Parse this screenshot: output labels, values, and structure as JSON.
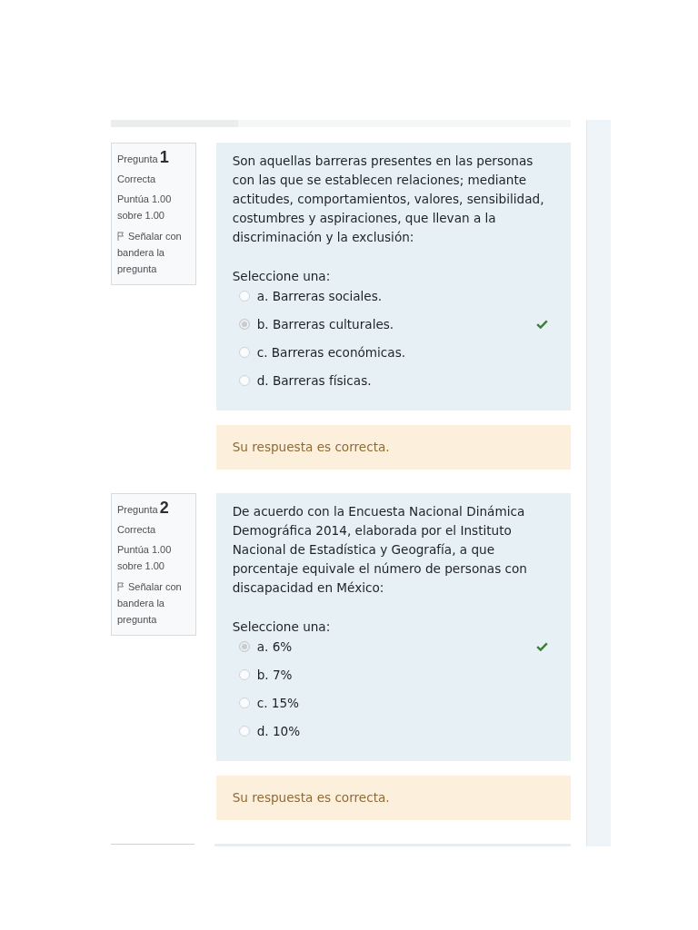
{
  "questions": [
    {
      "label": "Pregunta",
      "number": "1",
      "status": "Correcta",
      "grade": "Puntúa 1.00 sobre 1.00",
      "flag_link": "Señalar con bandera la pregunta",
      "text": "Son aquellas barreras presentes en las personas con las que se establecen relaciones; mediante actitudes, comportamientos, valores, sensibilidad, costumbres y aspiraciones, que llevan a la discriminación y la exclusión:",
      "prompt": "Seleccione una:",
      "options": [
        {
          "label": "a. Barreras sociales.",
          "selected": false,
          "correct": false
        },
        {
          "label": "b. Barreras culturales.",
          "selected": true,
          "correct": true
        },
        {
          "label": "c. Barreras económicas.",
          "selected": false,
          "correct": false
        },
        {
          "label": "d. Barreras físicas.",
          "selected": false,
          "correct": false
        }
      ],
      "feedback": "Su respuesta es correcta."
    },
    {
      "label": "Pregunta",
      "number": "2",
      "status": "Correcta",
      "grade": "Puntúa 1.00 sobre 1.00",
      "flag_link": "Señalar con bandera la pregunta",
      "text": "De acuerdo con la Encuesta Nacional Dinámica Demográfica 2014, elaborada por el Instituto Nacional de Estadística y Geografía, a que porcentaje equivale el número de personas con discapacidad en México:",
      "prompt": "Seleccione una:",
      "options": [
        {
          "label": "a. 6%",
          "selected": true,
          "correct": true
        },
        {
          "label": "b. 7%",
          "selected": false,
          "correct": false
        },
        {
          "label": "c. 15%",
          "selected": false,
          "correct": false
        },
        {
          "label": "d. 10%",
          "selected": false,
          "correct": false
        }
      ],
      "feedback": "Su respuesta es correcta."
    }
  ]
}
